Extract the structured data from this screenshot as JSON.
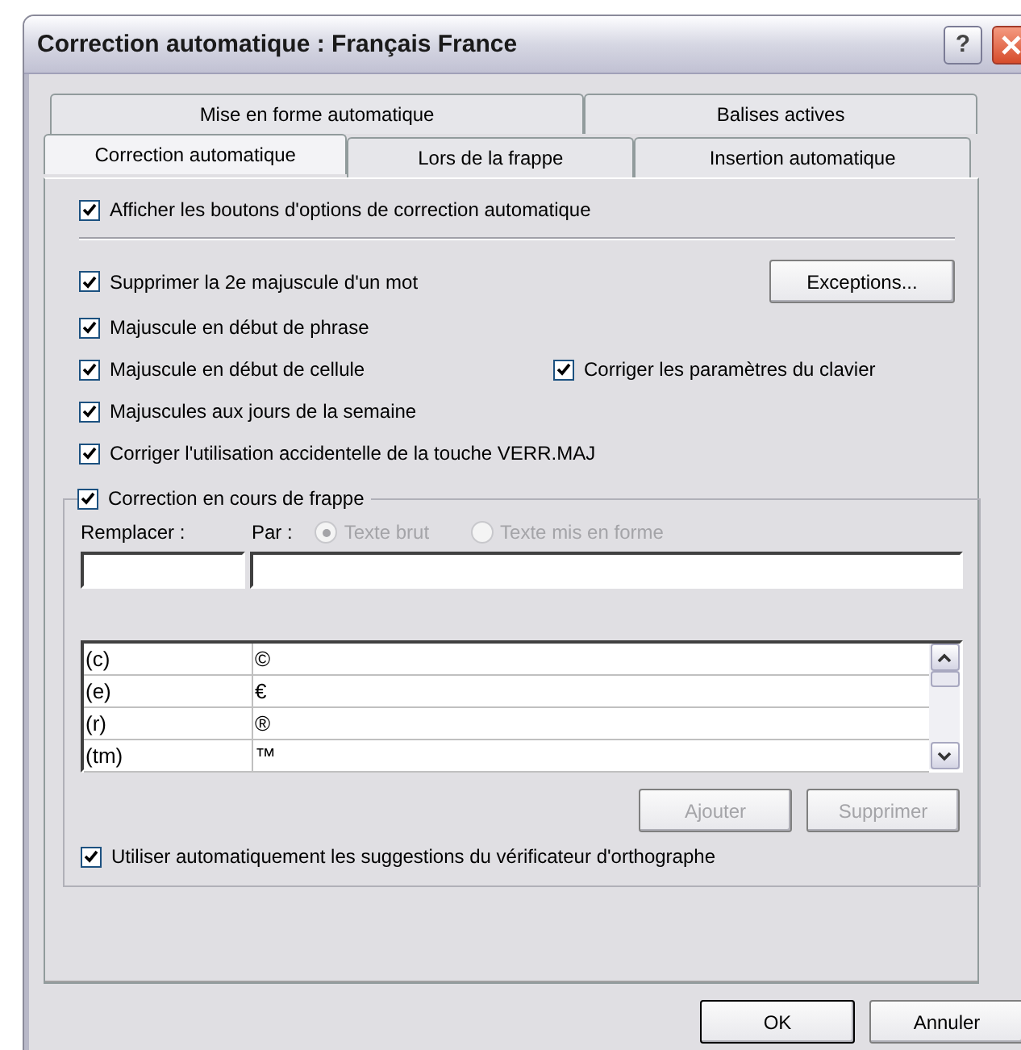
{
  "window": {
    "title": "Correction automatique : Français France",
    "help_button": "?"
  },
  "tab_rows": [
    [
      {
        "label": "Mise en forme automatique",
        "selected": false
      },
      {
        "label": "Balises actives",
        "selected": false
      }
    ],
    [
      {
        "label": "Correction automatique",
        "selected": true
      },
      {
        "label": "Lors de la frappe",
        "selected": false
      },
      {
        "label": "Insertion automatique",
        "selected": false
      }
    ]
  ],
  "show_options": {
    "label": "Afficher les boutons d'options de correction automatique",
    "checked": true
  },
  "option_rows": [
    {
      "checkbox": {
        "label": "Supprimer la 2e majuscule d'un mot",
        "checked": true
      },
      "button": "Exceptions..."
    },
    {
      "checkbox": {
        "label": "Majuscule en début de phrase",
        "checked": true
      }
    },
    {
      "checkbox": {
        "label": "Majuscule en début de cellule",
        "checked": true
      },
      "side_checkbox": {
        "label": "Corriger les paramètres du clavier",
        "checked": true
      }
    },
    {
      "checkbox": {
        "label": "Majuscules aux jours de la semaine",
        "checked": true
      }
    },
    {
      "checkbox": {
        "label": "Corriger l'utilisation accidentelle de la touche VERR.MAJ",
        "checked": true
      }
    }
  ],
  "replace_group": {
    "checkbox": {
      "label": "Correction en cours de frappe",
      "checked": true
    },
    "replace_label": "Remplacer :",
    "with_label": "Par :",
    "format_options": [
      {
        "label": "Texte brut",
        "selected": true,
        "disabled": true
      },
      {
        "label": "Texte mis en forme",
        "selected": false,
        "disabled": true
      }
    ],
    "entries": [
      {
        "replace": "(c)",
        "with": "©"
      },
      {
        "replace": "(e)",
        "with": "€"
      },
      {
        "replace": "(r)",
        "with": "®"
      },
      {
        "replace": "(tm)",
        "with": "™"
      }
    ],
    "add_button": {
      "label": "Ajouter",
      "disabled": true
    },
    "delete_button": {
      "label": "Supprimer",
      "disabled": true
    },
    "spelling": {
      "label": "Utiliser automatiquement les suggestions du vérificateur d'orthographe",
      "checked": true
    }
  },
  "buttons": [
    {
      "label": "OK",
      "default": true
    },
    {
      "label": "Annuler",
      "default": false
    }
  ]
}
